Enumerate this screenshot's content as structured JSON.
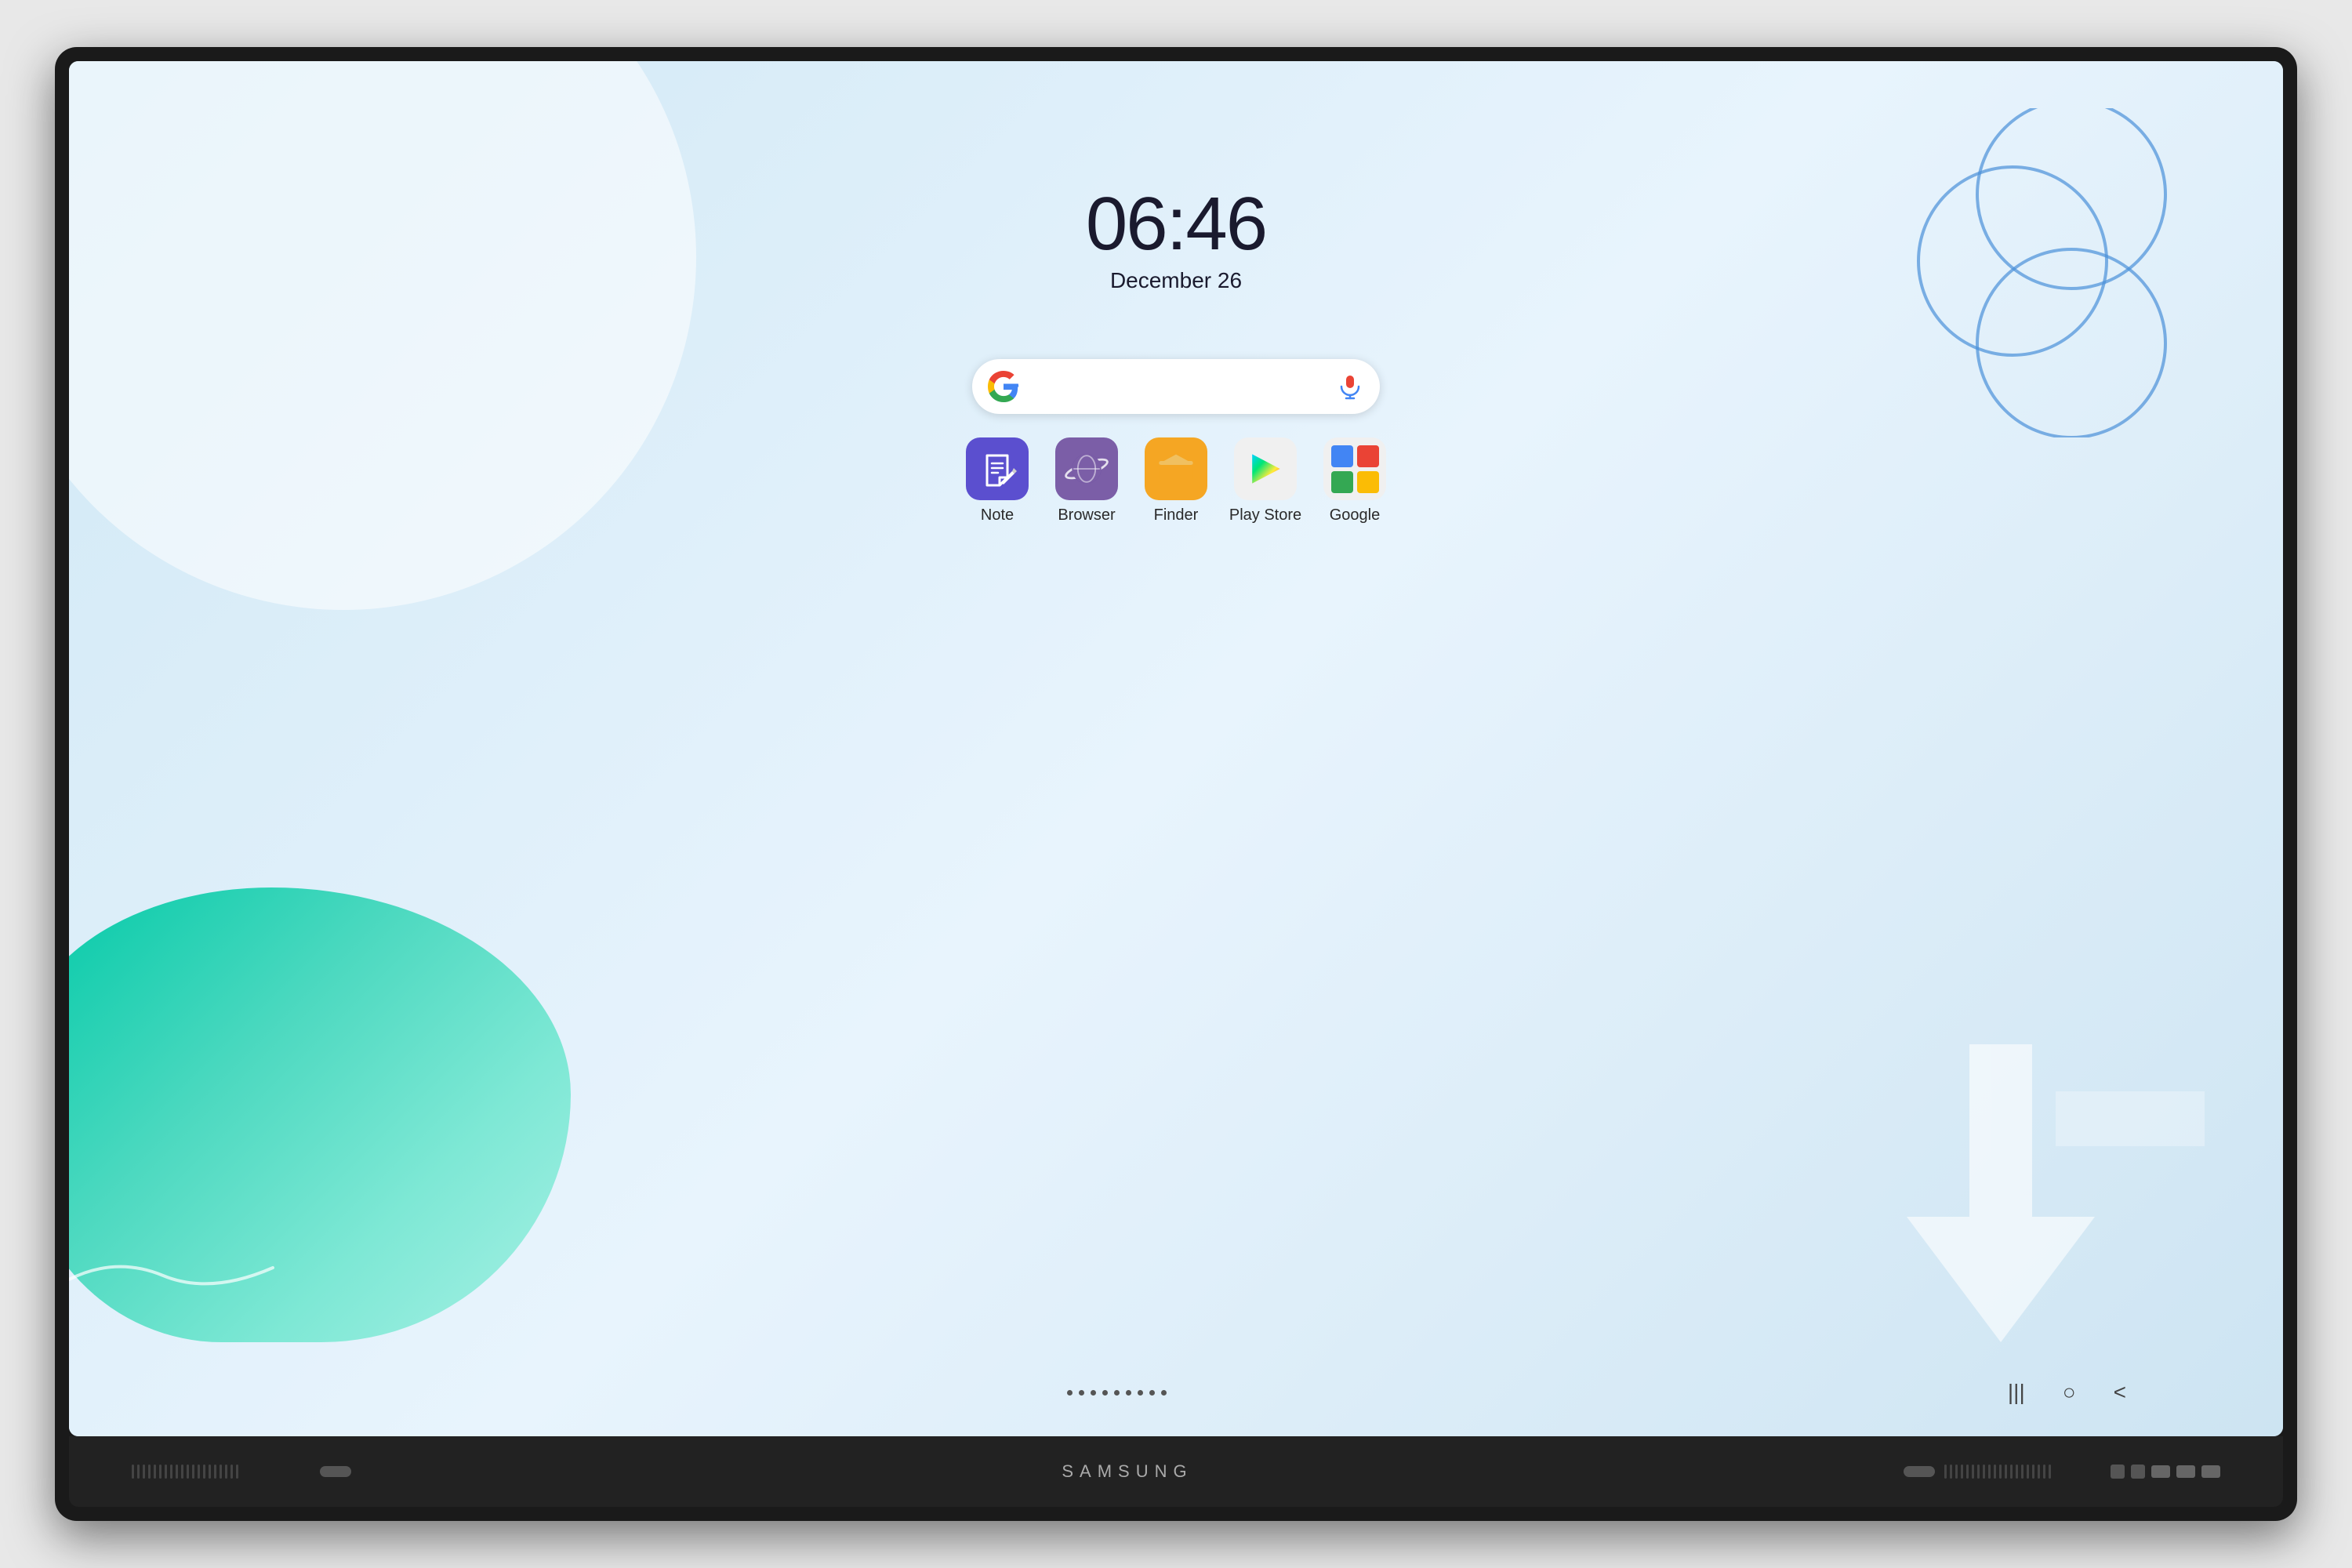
{
  "tv": {
    "brand": "SAMSUNG"
  },
  "screen": {
    "clock": {
      "time": "06:46",
      "date": "December 26"
    },
    "search": {
      "placeholder": ""
    },
    "apps": [
      {
        "id": "note",
        "label": "Note",
        "icon_type": "note",
        "color": "#5b4fcf"
      },
      {
        "id": "browser",
        "label": "Browser",
        "icon_type": "browser",
        "color": "#7b5ea7"
      },
      {
        "id": "finder",
        "label": "Finder",
        "icon_type": "finder",
        "color": "#f5a623"
      },
      {
        "id": "playstore",
        "label": "Play Store",
        "icon_type": "playstore",
        "color": "#f0f0f0"
      },
      {
        "id": "google",
        "label": "Google",
        "icon_type": "google",
        "color": "#f0f0f0"
      }
    ],
    "nav": {
      "recents_label": "|||",
      "home_label": "○",
      "back_label": "<"
    }
  }
}
